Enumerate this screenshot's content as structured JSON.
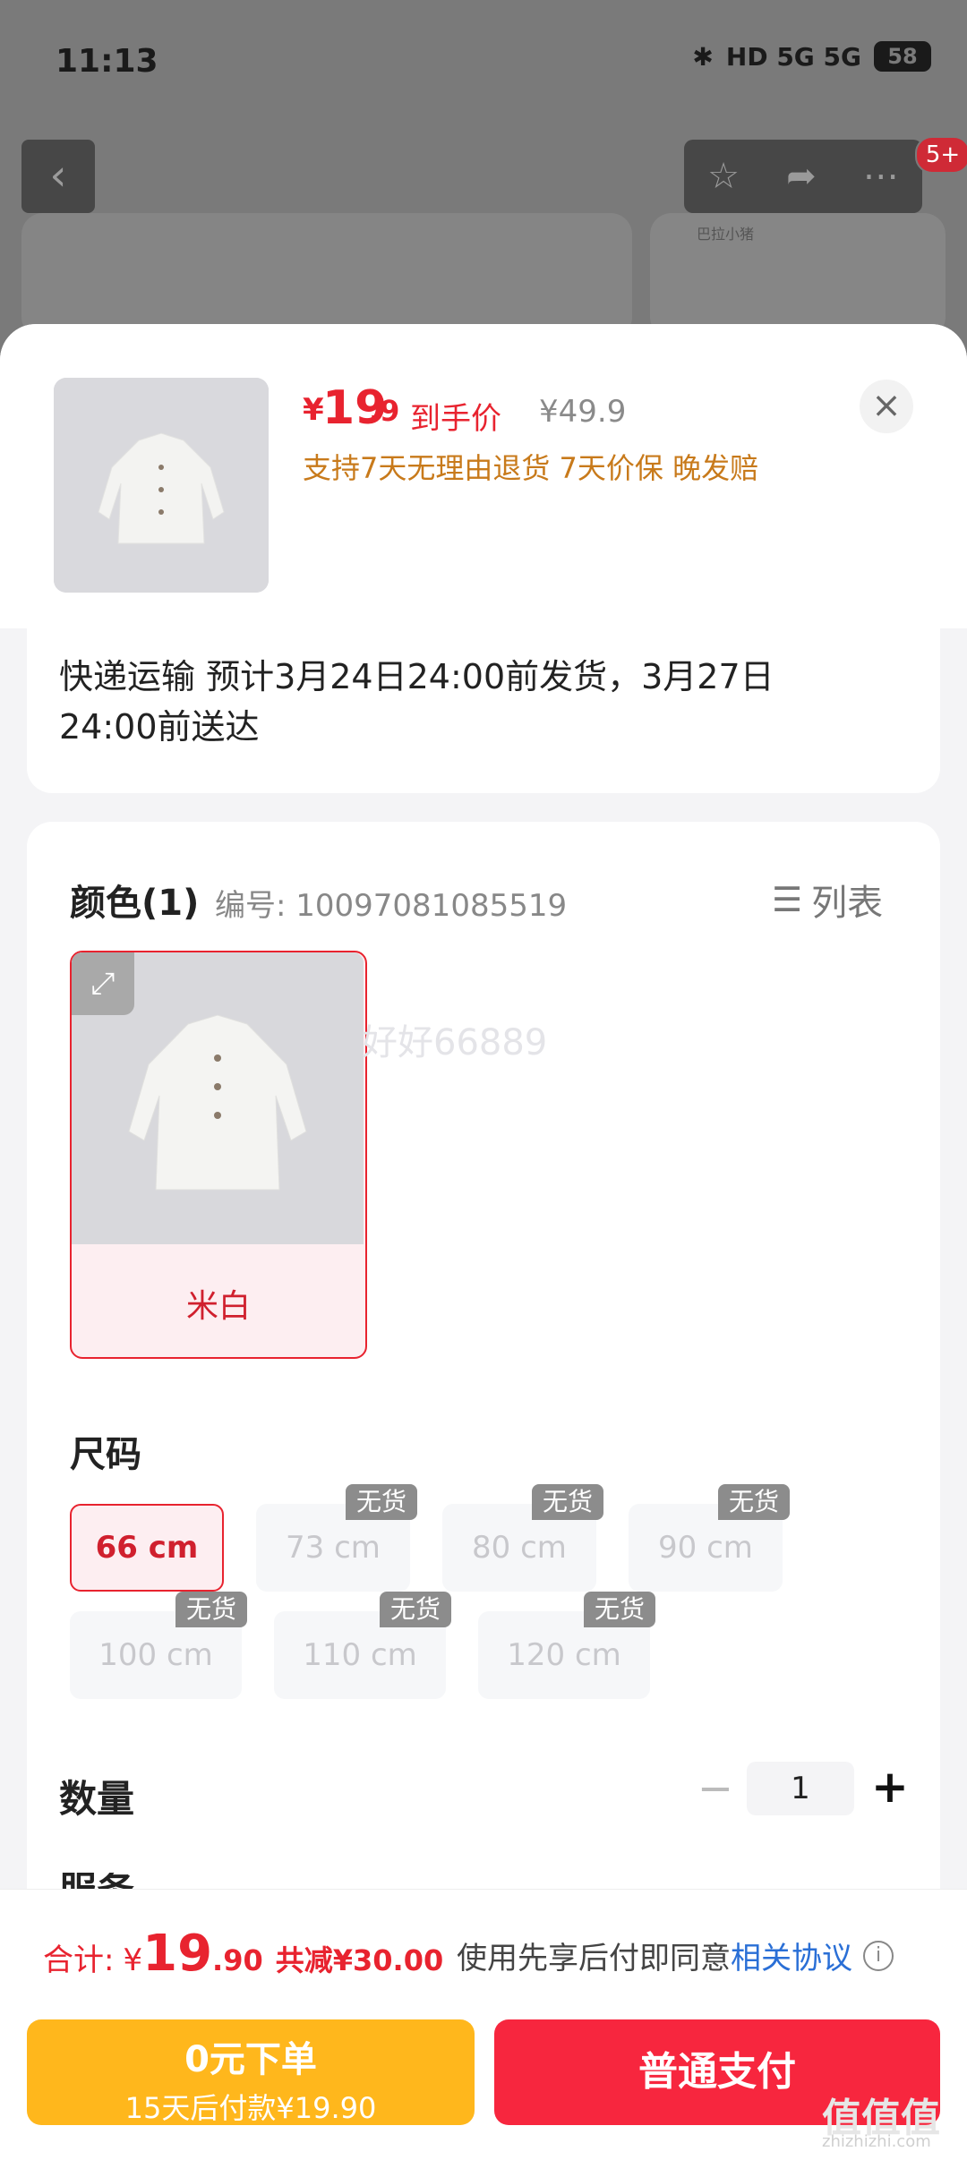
{
  "status_bar": {
    "time": "11:13",
    "icons": "HD 5G 5G",
    "battery": "58"
  },
  "header": {
    "badge": "5+"
  },
  "background": {
    "shop_logo_text": "巴拉小猪"
  },
  "product": {
    "price_currency": "¥",
    "price_int": "19",
    "price_dec": ".9",
    "price_tag": "到手价",
    "original_price": "¥49.9",
    "guarantee": "支持7天无理由退货  7天价保  晚发赔"
  },
  "shipping": {
    "text": "快递运输 预计3月24日24:00前发货，3月27日24:00前送达"
  },
  "color_section": {
    "title": "颜色(1)",
    "sku_number": "编号: 10097081085519",
    "list_toggle": "列表",
    "options": [
      {
        "label": "米白",
        "selected": true
      }
    ],
    "watermark": "好好66889"
  },
  "size_section": {
    "title": "尺码",
    "out_of_stock_label": "无货",
    "options": [
      {
        "label": "66 cm",
        "selected": true,
        "available": true
      },
      {
        "label": "73 cm",
        "selected": false,
        "available": false
      },
      {
        "label": "80 cm",
        "selected": false,
        "available": false
      },
      {
        "label": "90 cm",
        "selected": false,
        "available": false
      },
      {
        "label": "100 cm",
        "selected": false,
        "available": false
      },
      {
        "label": "110 cm",
        "selected": false,
        "available": false
      },
      {
        "label": "120 cm",
        "selected": false,
        "available": false
      }
    ]
  },
  "quantity": {
    "title": "数量",
    "value": "1",
    "minus": "−",
    "plus": "+"
  },
  "service_peek": "服务",
  "footer": {
    "total_label": "合计:",
    "total_currency": "¥",
    "total_int": "19",
    "total_dec": ".90",
    "discount": "共减¥30.00",
    "agree_text": "使用先享后付即同意",
    "agree_link": "相关协议",
    "btn_later_line1": "0元下单",
    "btn_later_line2": "15天后付款¥19.90",
    "btn_pay": "普通支付"
  },
  "watermark_corner": {
    "main": "值值值",
    "sub": "zhizhizhi.com"
  },
  "colors": {
    "accent_red": "#e8232f",
    "orange": "#ffb71c",
    "guarantee": "#c87a1b",
    "link": "#2a6fd6"
  }
}
